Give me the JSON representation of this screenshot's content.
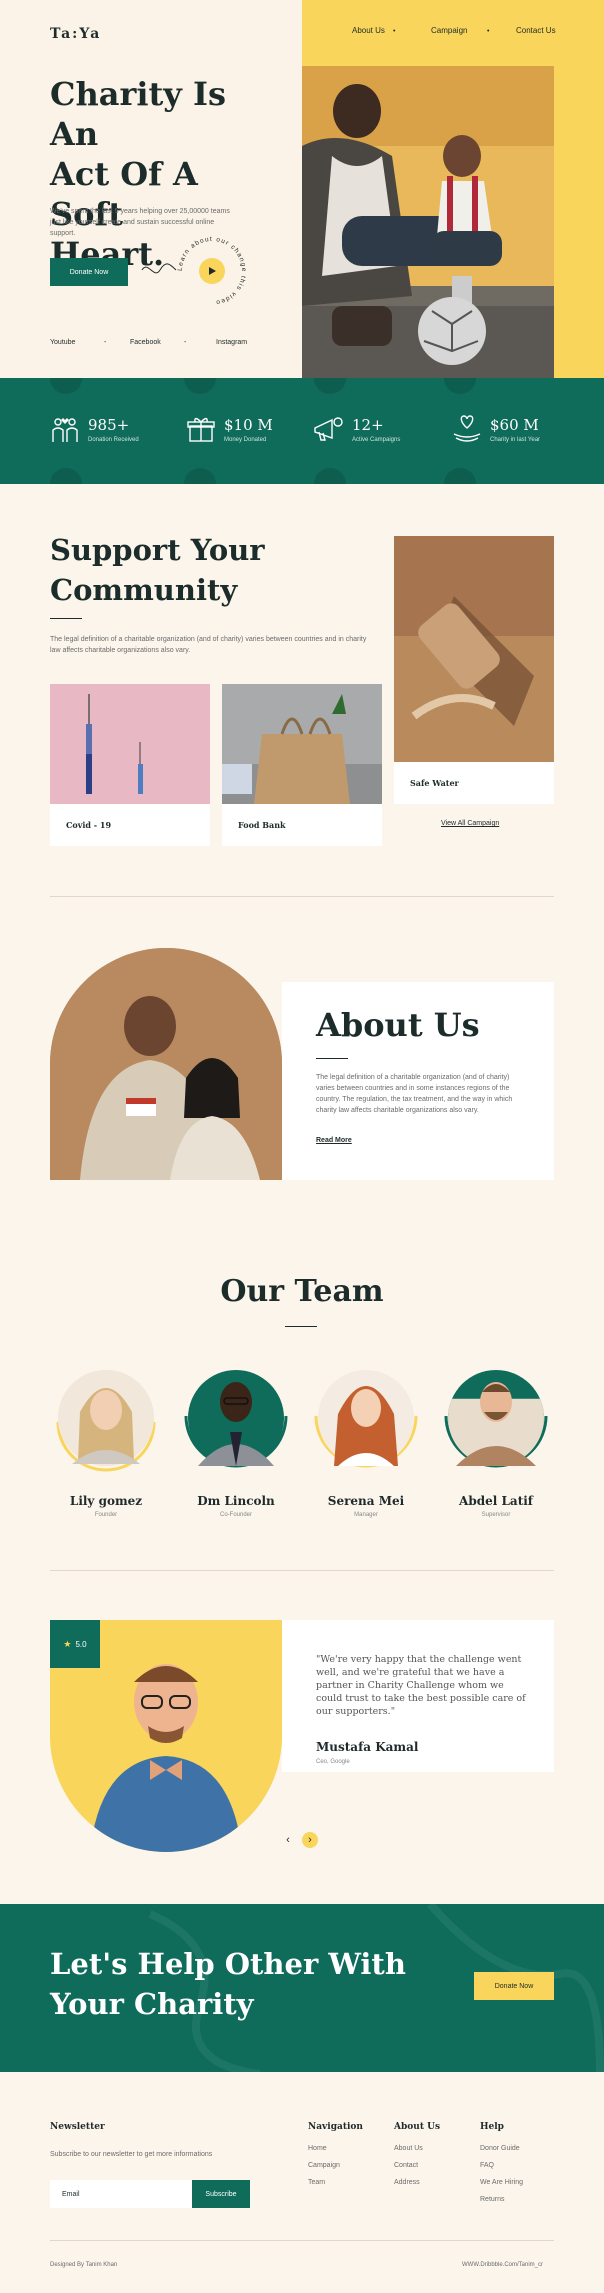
{
  "brand": {
    "logo": "Ta:Ya"
  },
  "nav": {
    "items": [
      "About Us",
      "Campaign",
      "Contact Us"
    ]
  },
  "hero": {
    "title_lines": [
      "Charity Is An",
      "Act Of A Soft",
      "Heart."
    ],
    "description": "We've spent the last 5 years helping over 25,00000 teams just like yourself create and sustain successful online support.",
    "donate_button": "Donate Now",
    "circle_text": "Learn about our change this video",
    "socials": [
      "Youtube",
      "Facebook",
      "Instagram"
    ]
  },
  "stats": [
    {
      "value": "985+",
      "label": "Donation Received",
      "icon": "charity-people-icon"
    },
    {
      "value": "$10 M",
      "label": "Money Donated",
      "icon": "gift-box-icon"
    },
    {
      "value": "12+",
      "label": "Active Campaigns",
      "icon": "megaphone-icon"
    },
    {
      "value": "$60 M",
      "label": "Charity in last Year",
      "icon": "hand-heart-icon"
    }
  ],
  "support": {
    "title_lines": [
      "Support Your",
      "Community"
    ],
    "description": "The legal definition of a charitable organization (and of charity) varies between countries and in charity law affects charitable organizations also vary.",
    "cards": [
      "Covid - 19",
      "Food Bank",
      "Safe Water"
    ],
    "view_all": "View All Campaign"
  },
  "about": {
    "title": "About Us",
    "description": "The legal definition of a charitable organization (and of charity) varies between countries and in some instances regions of the country. The regulation, the tax treatment, and the way in which charity law affects charitable organizations also vary.",
    "read_more": "Read More"
  },
  "team": {
    "title": "Our Team",
    "members": [
      {
        "name": "Lily gomez",
        "role": "Founder"
      },
      {
        "name": "Dm Lincoln",
        "role": "Co-Founder"
      },
      {
        "name": "Serena Mei",
        "role": "Manager"
      },
      {
        "name": "Abdel Latif",
        "role": "Supervisor"
      }
    ]
  },
  "testimonial": {
    "rating": "5.0",
    "quote": "\"We're very happy that the challenge went well, and we're grateful that we have a partner in Charity Challenge whom we could trust to take the best possible care of our supporters.\"",
    "name": "Mustafa Kamal",
    "role": "Ceo, Google"
  },
  "cta": {
    "title_lines": [
      "Let's Help Other With",
      "Your Charity"
    ],
    "button": "Donate Now"
  },
  "footer": {
    "newsletter_title": "Newsletter",
    "newsletter_desc": "Subscribe to our newsletter to get more informations",
    "email_placeholder": "Email",
    "subscribe": "Subscribe",
    "columns": [
      {
        "title": "Navigation",
        "links": [
          "Home",
          "Campaign",
          "Team"
        ]
      },
      {
        "title": "About Us",
        "links": [
          "About Us",
          "Contact",
          "Address"
        ]
      },
      {
        "title": "Help",
        "links": [
          "Donor Guide",
          "FAQ",
          "We Are Hiring",
          "Returns"
        ]
      }
    ],
    "designer": "Designed By Tanim Khan",
    "dribbble": "WWW.Dribbble.Com/Tanim_cr"
  },
  "colors": {
    "green": "#0f6b5a",
    "yellow": "#f9d55b",
    "cream": "#fbf5ec"
  }
}
